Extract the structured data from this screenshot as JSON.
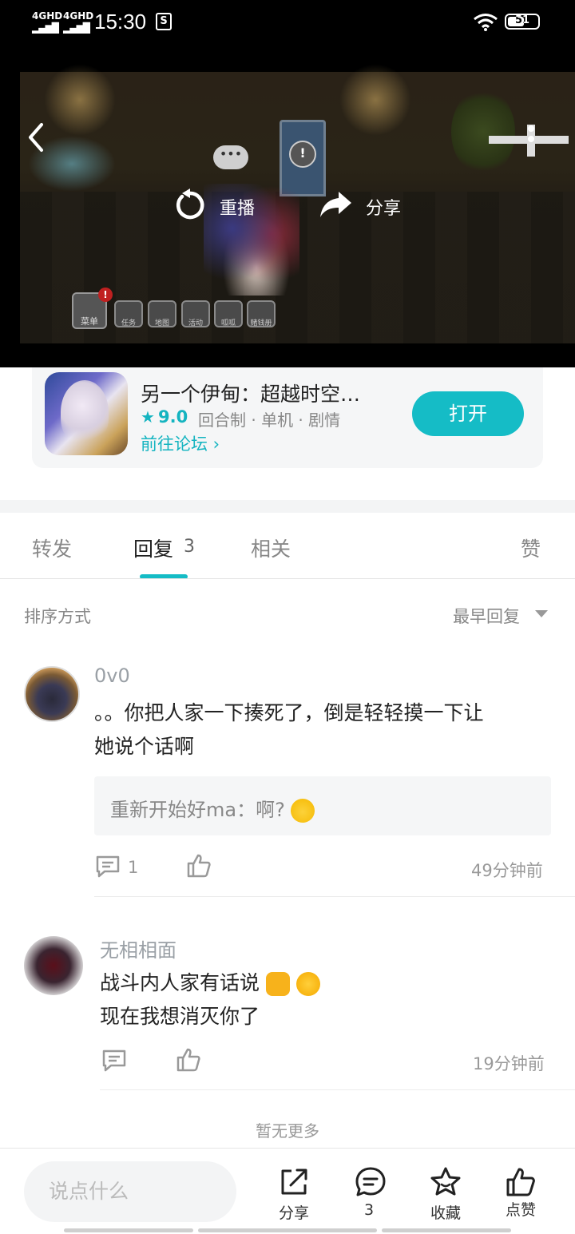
{
  "status_bar": {
    "network1": "4GHD",
    "network2": "4GHD",
    "time": "15:30",
    "battery": "51"
  },
  "video": {
    "replay_label": "重播",
    "share_label": "分享",
    "hud_buttons": [
      "菜单",
      "任务",
      "地图",
      "活动",
      "呱呱",
      "赌钱册"
    ]
  },
  "game": {
    "title": "另一个伊甸：超越时空…",
    "score": "9.0",
    "tags": "回合制 · 单机 · 剧情",
    "forum_link": "前往论坛 ›",
    "open_label": "打开"
  },
  "tabs": {
    "forward": "转发",
    "reply": "回复",
    "reply_count": "3",
    "related": "相关",
    "like": "赞"
  },
  "sort": {
    "label": "排序方式",
    "value": "最早回复"
  },
  "comments": [
    {
      "user": "0v0",
      "line1": "。。你把人家一下揍死了，倒是轻轻摸一下让",
      "line2": "她说个话啊",
      "quote": "重新开始好ma：啊?",
      "reply_count": "1",
      "time": "49分钟前"
    },
    {
      "user": "无相相面",
      "line1": "战斗内人家有话说",
      "line2": "现在我想消灭你了",
      "time": "19分钟前"
    }
  ],
  "no_more": "暂无更多",
  "bottom_bar": {
    "input_placeholder": "说点什么",
    "share": "分享",
    "comments": "3",
    "collect": "收藏",
    "like": "点赞"
  }
}
